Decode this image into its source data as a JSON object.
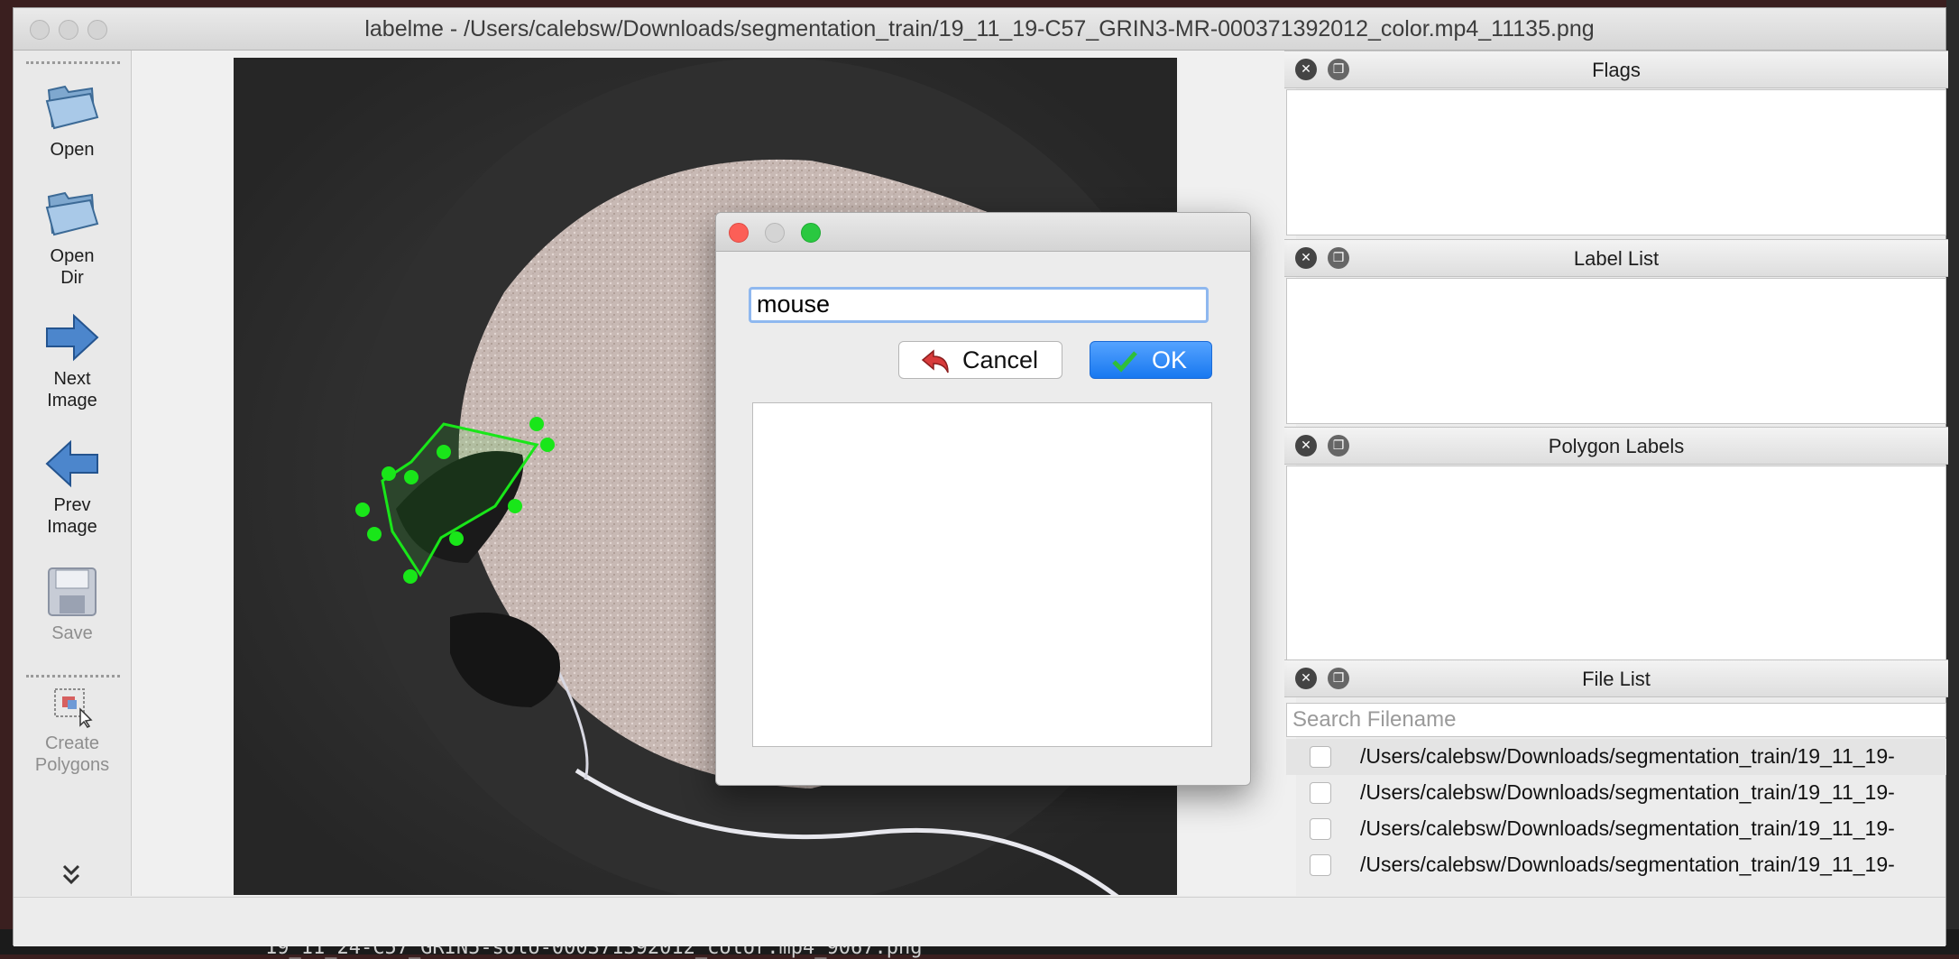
{
  "window": {
    "title": "labelme - /Users/calebsw/Downloads/segmentation_train/19_11_19-C57_GRIN3-MR-000371392012_color.mp4_11135.png"
  },
  "toolbar": {
    "open_label": "Open",
    "open_dir_label_1": "Open",
    "open_dir_label_2": "Dir",
    "next_label_1": "Next",
    "next_label_2": "Image",
    "prev_label_1": "Prev",
    "prev_label_2": "Image",
    "save_label": "Save",
    "create_label_1": "Create",
    "create_label_2": "Polygons"
  },
  "docks": {
    "flags_title": "Flags",
    "label_list_title": "Label List",
    "polygon_labels_title": "Polygon Labels",
    "file_list_title": "File List",
    "search_placeholder": "Search Filename",
    "files": [
      "/Users/calebsw/Downloads/segmentation_train/19_11_19-",
      "/Users/calebsw/Downloads/segmentation_train/19_11_19-",
      "/Users/calebsw/Downloads/segmentation_train/19_11_19-",
      "/Users/calebsw/Downloads/segmentation_train/19_11_19-"
    ]
  },
  "dialog": {
    "input_value": "mouse",
    "cancel_label": "Cancel",
    "ok_label": "OK"
  },
  "background": {
    "terminal_text": "19_11_24-C57_GRIN5-solo-000371392012_color.mp4_9067.png"
  },
  "colors": {
    "polygon": "#19e619",
    "ok_button": "#1e7ef2",
    "close_red": "#fc5f57",
    "zoom_green": "#2ac840"
  }
}
